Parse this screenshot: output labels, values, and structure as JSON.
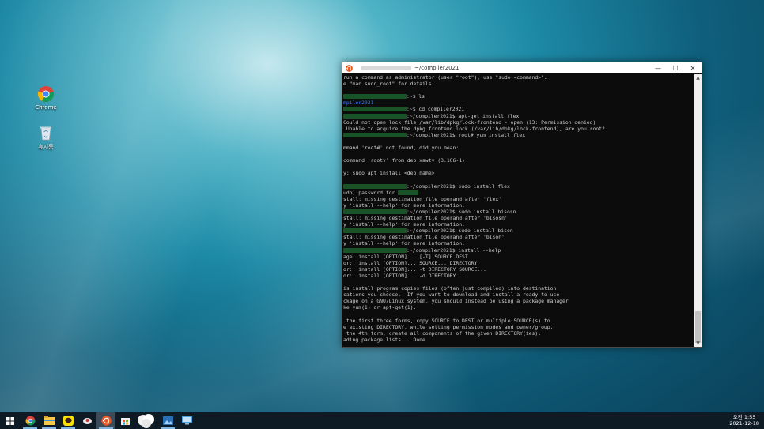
{
  "desktop": {
    "icons": [
      {
        "label": "Chrome",
        "icon": "chrome-icon"
      },
      {
        "label": "휴지통",
        "icon": "recycle-bin-icon"
      }
    ]
  },
  "window": {
    "title": "~/compiler2021",
    "controls": {
      "minimize": "—",
      "maximize": "☐",
      "close": "✕"
    },
    "accent": "#e95420"
  },
  "terminal": {
    "lines": [
      "run a command as administrator (user \"root\"), use \"sudo <command>\".",
      "e \"man sudo_root\" for details.",
      "",
      ":~$ ls",
      "mpiler2021",
      ":~$ cd compiler2021",
      ":~/compiler2021$ apt-get install flex",
      "Could not open lock file /var/lib/dpkg/lock-frontend - open (13: Permission denied)",
      " Unable to acquire the dpkg frontend lock (/var/lib/dpkg/lock-frontend), are you root?",
      ":~/compiler2021$ root# yum install flex",
      "",
      "mmand 'root#' not found, did you mean:",
      "",
      "command 'rootv' from deb xawtv (3.106-1)",
      "",
      "y: sudo apt install <deb name>",
      "",
      ":~/compiler2021$ sudo install flex",
      "udo] password for",
      "stall: missing destination file operand after 'flex'",
      "y 'install --help' for more information.",
      ":~/compiler2021$ sudo install bisosn",
      "stall: missing destination file operand after 'bisosn'",
      "y 'install --help' for more information.",
      ":~/compiler2021$ sudo install bison",
      "stall: missing destination file operand after 'bison'",
      "y 'install --help' for more information.",
      ":~/compiler2021$ install --help",
      "age: install [OPTION]... [-T] SOURCE DEST",
      "or:  install [OPTION]... SOURCE... DIRECTORY",
      "or:  install [OPTION]... -t DIRECTORY SOURCE...",
      "or:  install [OPTION]... -d DIRECTORY...",
      "",
      "is install program copies files (often just compiled) into destination",
      "cations you choose.  If you want to download and install a ready-to-use",
      "ckage on a GNU/Linux system, you should instead be using a package manager",
      "ke yum(1) or apt-get(1).",
      "",
      " the first three forms, copy SOURCE to DEST or multiple SOURCE(s) to",
      "e existing DIRECTORY, while setting permission modes and owner/group.",
      " the 4th form, create all components of the given DIRECTORY(ies).",
      "ading package lists... Done"
    ]
  },
  "taskbar": {
    "items": [
      {
        "icon": "windows-start-icon"
      },
      {
        "icon": "chrome-icon"
      },
      {
        "icon": "file-explorer-icon"
      },
      {
        "icon": "kakaotalk-icon"
      },
      {
        "icon": "app-icon"
      },
      {
        "icon": "ubuntu-icon"
      },
      {
        "icon": "store-icon"
      },
      {
        "icon": "blurred-app-icon"
      },
      {
        "icon": "photos-icon"
      },
      {
        "icon": "remote-desktop-icon"
      }
    ],
    "clock": {
      "time": "오전 1:55",
      "date": "2021-12-18"
    }
  }
}
